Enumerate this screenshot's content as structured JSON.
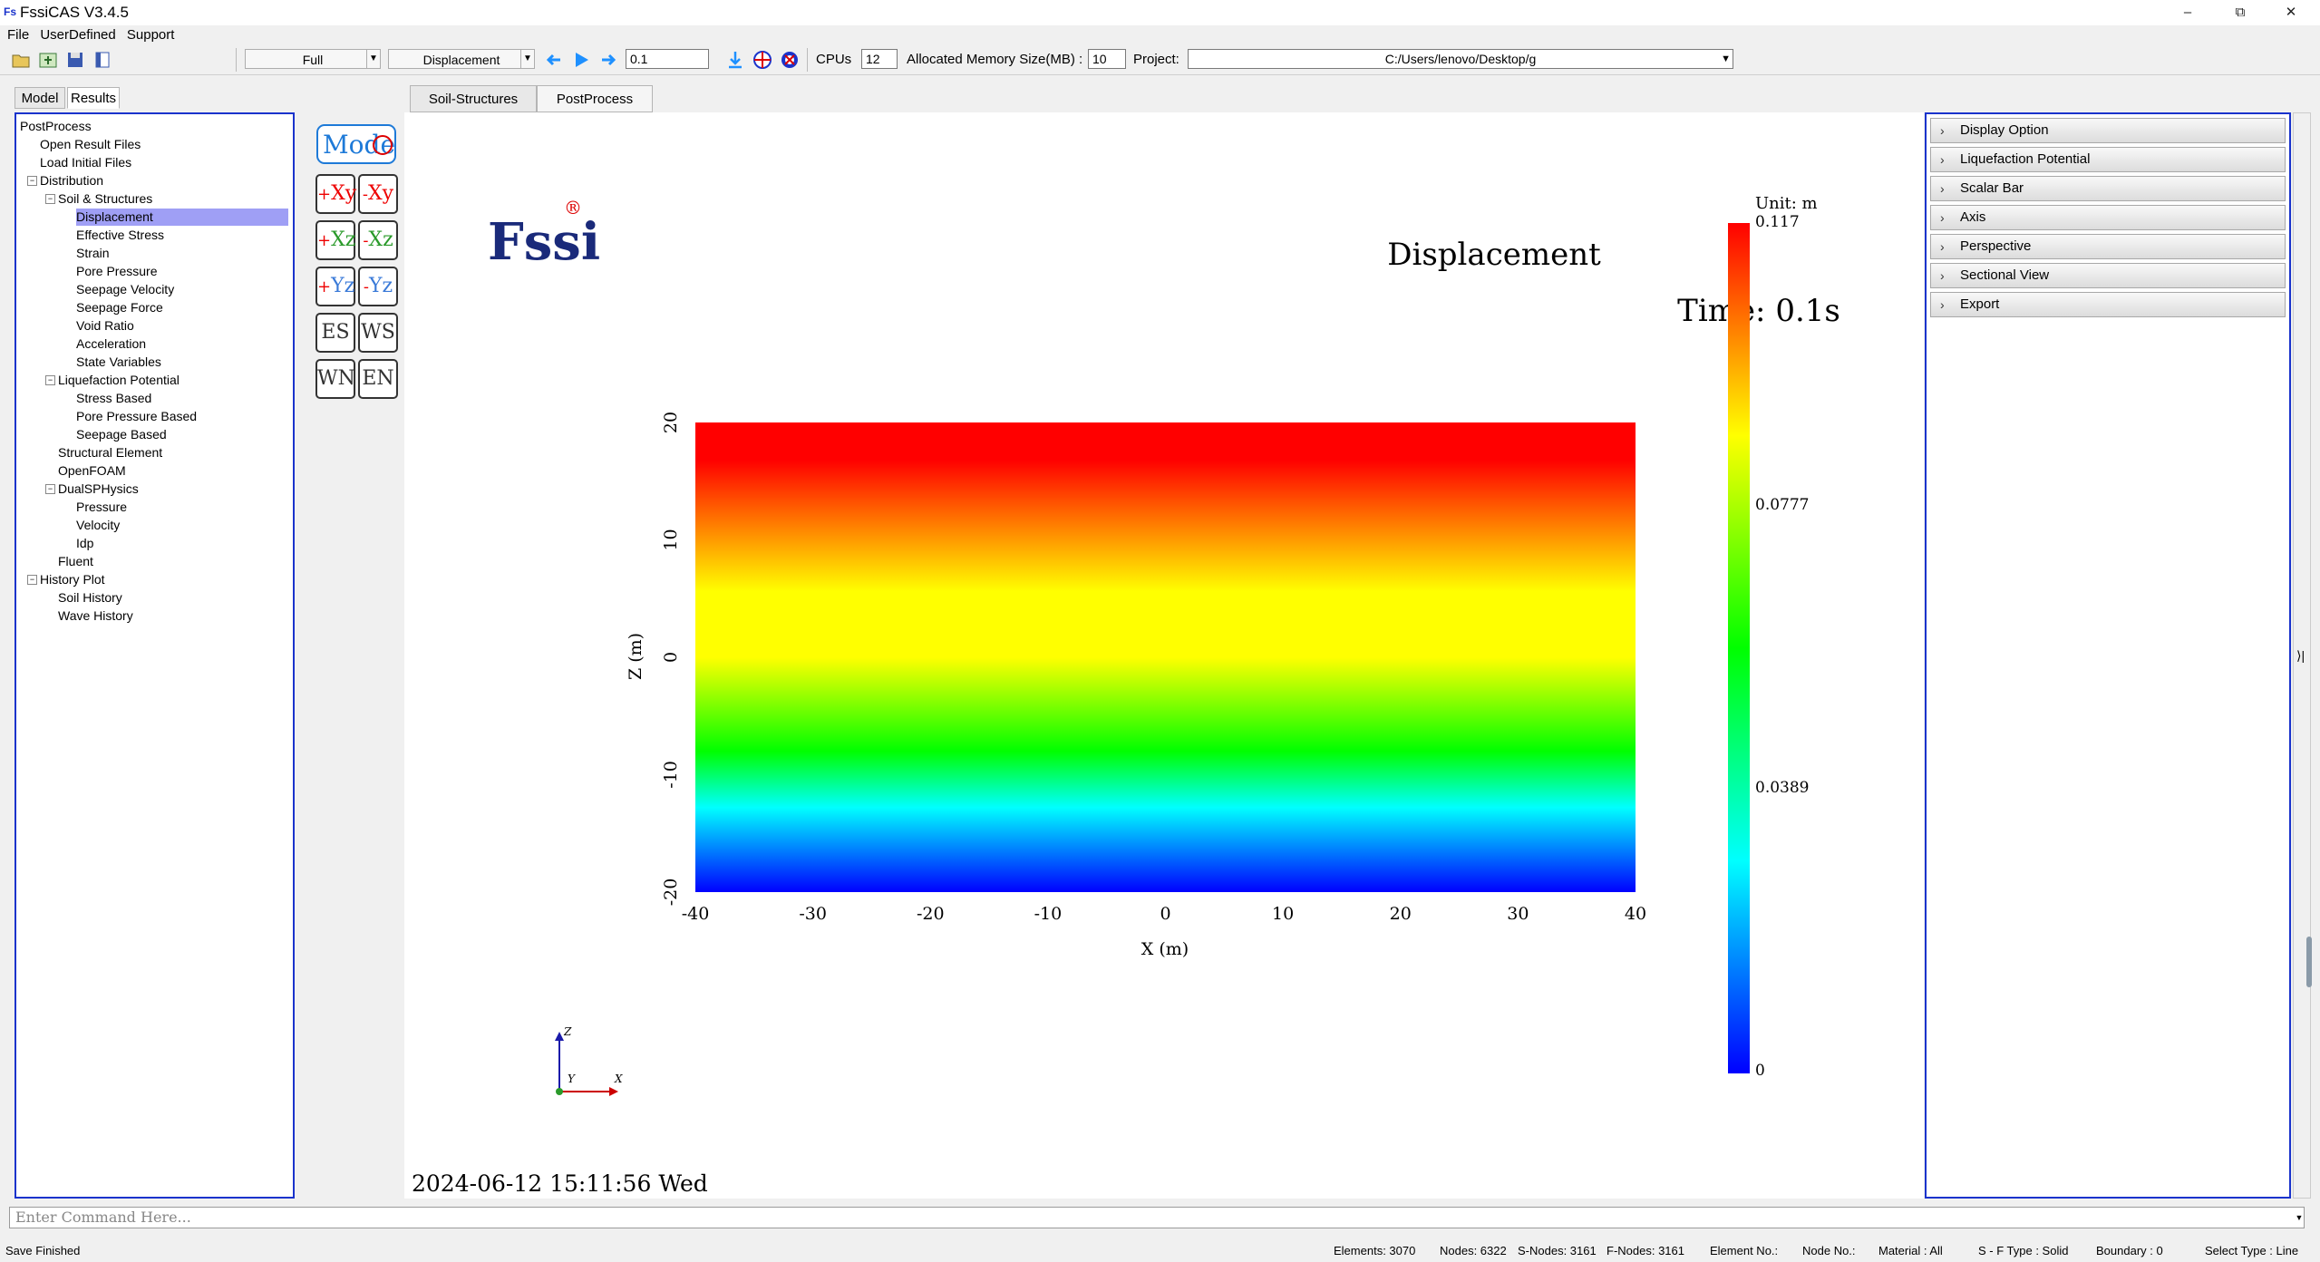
{
  "window": {
    "title": "FssiCAS V3.4.5",
    "min": "–",
    "restore": "⧉",
    "close": "✕"
  },
  "menu": [
    "File",
    "UserDefined",
    "Support"
  ],
  "toolbar": {
    "mode_combo": "Full",
    "result_combo": "Displacement",
    "time_value": "0.1",
    "cpus_label": "CPUs",
    "cpus_value": "12",
    "memory_label": "Allocated Memory Size(MB) :",
    "memory_value": "10",
    "project_label": "Project:",
    "project_path": "C:/Users/lenovo/Desktop/g"
  },
  "left_tabs": [
    "Model",
    "Results"
  ],
  "tree": [
    {
      "label": "PostProcess",
      "level": 0
    },
    {
      "label": "Open Result Files",
      "level": 1
    },
    {
      "label": "Load Initial Files",
      "level": 1
    },
    {
      "label": "Distribution",
      "level": 1,
      "expander": "−"
    },
    {
      "label": "Soil & Structures",
      "level": 2,
      "expander": "−"
    },
    {
      "label": "Displacement",
      "level": 3,
      "selected": true
    },
    {
      "label": "Effective Stress",
      "level": 3
    },
    {
      "label": "Strain",
      "level": 3
    },
    {
      "label": "Pore Pressure",
      "level": 3
    },
    {
      "label": "Seepage Velocity",
      "level": 3
    },
    {
      "label": "Seepage Force",
      "level": 3
    },
    {
      "label": "Void Ratio",
      "level": 3
    },
    {
      "label": "Acceleration",
      "level": 3
    },
    {
      "label": "State Variables",
      "level": 3
    },
    {
      "label": "Liquefaction Potential",
      "level": 2,
      "expander": "−"
    },
    {
      "label": "Stress Based",
      "level": 3
    },
    {
      "label": "Pore Pressure Based",
      "level": 3
    },
    {
      "label": "Seepage Based",
      "level": 3
    },
    {
      "label": "Structural Element",
      "level": 2
    },
    {
      "label": "OpenFOAM",
      "level": 2
    },
    {
      "label": "DualSPHysics",
      "level": 2,
      "expander": "−"
    },
    {
      "label": "Pressure",
      "level": 3
    },
    {
      "label": "Velocity",
      "level": 3
    },
    {
      "label": "Idp",
      "level": 3
    },
    {
      "label": "Fluent",
      "level": 2
    },
    {
      "label": "History Plot",
      "level": 1,
      "expander": "−"
    },
    {
      "label": "Soil History",
      "level": 2
    },
    {
      "label": "Wave History",
      "level": 2
    }
  ],
  "view_buttons": {
    "mode_label": "Mode",
    "rows": [
      [
        {
          "sign": "+",
          "axes": "Xy",
          "cls": "xy"
        },
        {
          "sign": "-",
          "axes": "Xy",
          "cls": "xy"
        }
      ],
      [
        {
          "sign": "+",
          "axes": "Xz",
          "cls": "xz"
        },
        {
          "sign": "-",
          "axes": "Xz",
          "cls": "xz"
        }
      ],
      [
        {
          "sign": "+",
          "axes": "Yz",
          "cls": "yz"
        },
        {
          "sign": "-",
          "axes": "Yz",
          "cls": "yz"
        }
      ],
      [
        {
          "sign": "",
          "axes": "ES",
          "cls": ""
        },
        {
          "sign": "",
          "axes": "WS",
          "cls": ""
        }
      ],
      [
        {
          "sign": "",
          "axes": "WN",
          "cls": ""
        },
        {
          "sign": "",
          "axes": "EN",
          "cls": ""
        }
      ]
    ]
  },
  "center_tabs": [
    "Soil-Structures",
    "PostProcess"
  ],
  "plot": {
    "title": "Displacement",
    "time": "Time: 0.1s",
    "logo": "Fssi",
    "logo_mark": "®",
    "colorbar_unit": "Unit:  m",
    "colorbar_labels": [
      "0.117",
      "0.0777",
      "0.0389",
      "0"
    ],
    "axis_triad": {
      "z": "Z",
      "y": "Y",
      "x": "X"
    },
    "timestamp": "2024-06-12 15:11:56 Wed"
  },
  "chart_data": {
    "type": "heatmap",
    "title": "Displacement",
    "subtitle": "Time: 0.1s",
    "xlabel": "X (m)",
    "ylabel": "Z (m)",
    "xlim": [
      -40,
      40
    ],
    "ylim": [
      -20,
      20
    ],
    "xticks": [
      -40,
      -30,
      -20,
      -10,
      0,
      10,
      20,
      30,
      40
    ],
    "yticks": [
      20,
      10,
      0,
      -10,
      -20
    ],
    "color_range": [
      0,
      0.117
    ],
    "colorbar_ticks": [
      0.117,
      0.0777,
      0.0389,
      0
    ],
    "unit": "m",
    "gradient_along": "Z (increasing displacement with height)",
    "colors": [
      "#0000ff",
      "#00ffff",
      "#00ff00",
      "#ffff00",
      "#ff0000"
    ]
  },
  "right_panel": [
    "Display Option",
    "Liquefaction Potential",
    "Scalar Bar",
    "Axis",
    "Perspective",
    "Sectional View",
    "Export"
  ],
  "command": {
    "placeholder": "Enter Command Here..."
  },
  "status": {
    "left": "Save Finished",
    "elements": "Elements: 3070",
    "nodes": "Nodes: 6322",
    "s_nodes": "S-Nodes: 3161",
    "f_nodes": "F-Nodes: 3161",
    "element_no": "Element No.:",
    "node_no": "Node No.:",
    "material": "Material :  All",
    "sf_type": "S - F Type :  Solid",
    "boundary": "Boundary :  0",
    "select_type": "Select Type :  Line"
  }
}
